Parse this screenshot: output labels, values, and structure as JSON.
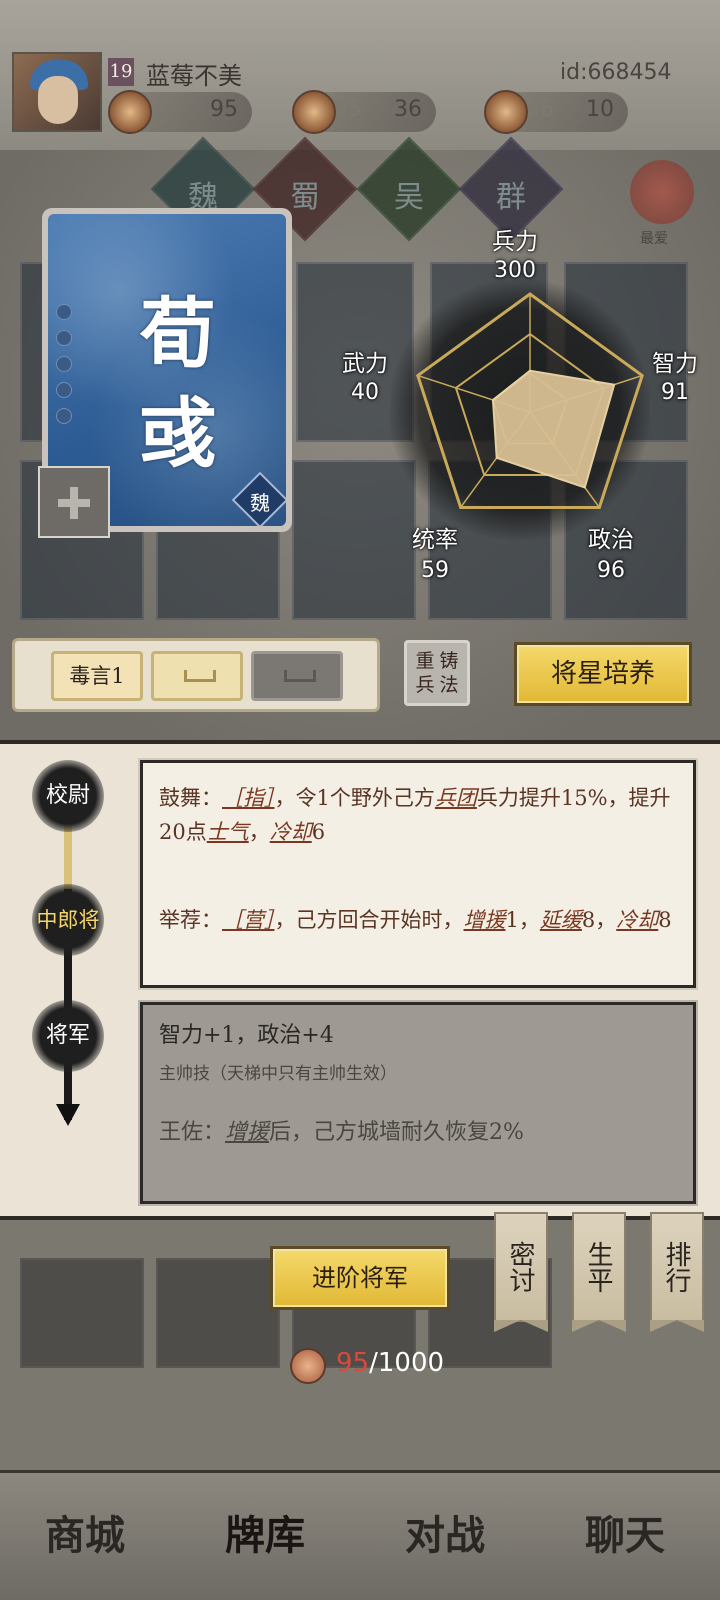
{
  "player": {
    "level": "19",
    "name": "蓝莓不美",
    "id": "id:668454",
    "resources": [
      {
        "icon": "crossed-swords-icon",
        "value": "95"
      },
      {
        "icon": "scroll-icon",
        "value": "95",
        "value2": "36"
      },
      {
        "icon": "gem-icon",
        "value": "36",
        "value2": "10"
      }
    ]
  },
  "factions": [
    "魏",
    "蜀",
    "吴",
    "群"
  ],
  "side_tab": "最爱",
  "hero": {
    "name": "荀彧",
    "faction": "魏"
  },
  "stats": {
    "troops": {
      "label": "兵力",
      "value": "300"
    },
    "force": {
      "label": "武力",
      "value": "40"
    },
    "intel": {
      "label": "智力",
      "value": "91"
    },
    "command": {
      "label": "统率",
      "value": "59"
    },
    "politics": {
      "label": "政治",
      "value": "96"
    }
  },
  "radar_values": {
    "troops": 0.35,
    "force": 0.33,
    "intel": 0.75,
    "command": 0.48,
    "politics": 0.79
  },
  "skill_slots": [
    "毒言1",
    "",
    ""
  ],
  "reforge_label": [
    "重",
    "铸",
    "兵",
    "法"
  ],
  "train_button": "将星培养",
  "ranks": [
    "校尉",
    "中郎将",
    "将军"
  ],
  "skills": {
    "skill1_a": "鼓舞：",
    "skill1_tag": "［指］",
    "skill1_b": "，令1个野外己方",
    "skill1_kw1": "兵团",
    "skill1_c": "兵力提升15%，提升20点",
    "skill1_kw2": "士气",
    "skill1_d": "，",
    "skill1_kw3": "冷却",
    "skill1_e": "6",
    "skill2_a": "举荐：",
    "skill2_tag": "［营］",
    "skill2_b": "，己方回合开始时，",
    "skill2_kw1": "增援",
    "skill2_c": "1，",
    "skill2_kw2": "延缓",
    "skill2_d": "8，",
    "skill2_kw3": "冷却",
    "skill2_e": "8"
  },
  "locked": {
    "title": "智力+1，政治+4",
    "subtitle": "主帅技（天梯中只有主帅生效）",
    "effect_a": "王佐：",
    "effect_kw": "增援",
    "effect_b": "后，己方城墙耐久恢复2%"
  },
  "advance_button": "进阶将军",
  "side_tabs": [
    "密讨",
    "生平",
    "排行"
  ],
  "progress": {
    "current": "95",
    "total": "/1000"
  },
  "nav": [
    "商城",
    "牌库",
    "对战",
    "聊天"
  ]
}
